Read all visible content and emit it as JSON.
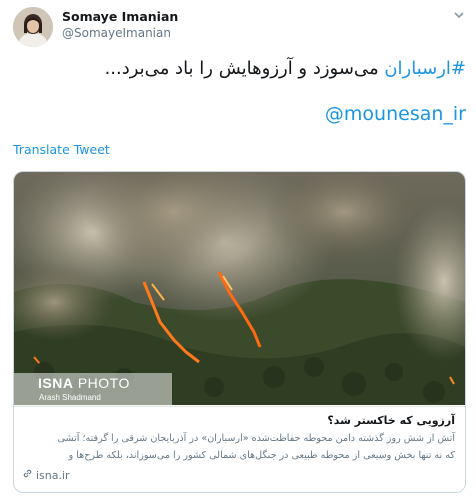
{
  "author": {
    "name": "Somaye Imanian",
    "handle": "@SomayeImanian"
  },
  "tweet": {
    "hashtag": "#ارسباران",
    "text": " می‌سوزد و آرزوهایش را باد می‌برد...",
    "mention": "@mounesan_ir",
    "translate_label": "Translate Tweet"
  },
  "card": {
    "image_badge": {
      "brand": "ISNA",
      "brand_suffix": " PHOTO",
      "credit": "Arash Shadmand"
    },
    "title": "آرزویی که خاکستر شد؟",
    "description_line1": "آتش از شش روز گذشته دامن محوطه حفاظت‌شده «ارسباران» در آذربایجان شرقی را گرفته؛ آتشی",
    "description_line2": "که نه تنها بخش وسیعی از محوطه طبیعی در جنگل‌های شمالی کشور را می‌سوزاند، بلکه طرح‌ها و",
    "domain": "isna.ir"
  },
  "icons": [
    "chevron-down-icon",
    "link-icon"
  ],
  "colors": {
    "link": "#1b95e0",
    "secondary": "#657786",
    "border": "#ccd6dd"
  }
}
